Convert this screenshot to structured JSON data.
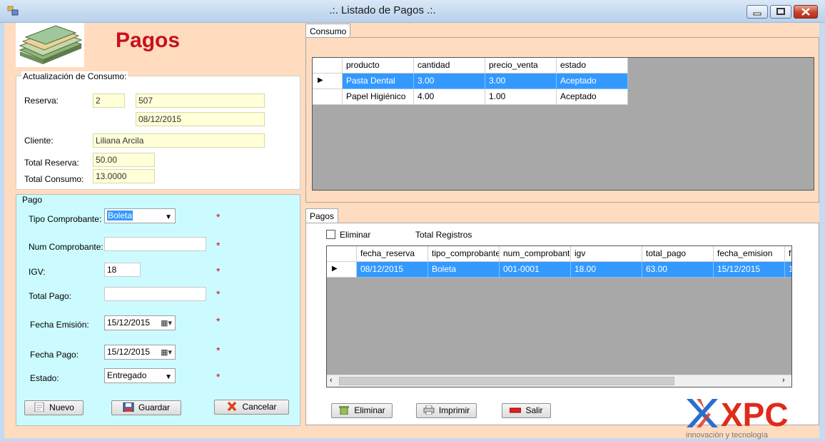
{
  "window": {
    "title": ".:. Listado de Pagos .:."
  },
  "header": {
    "title": "Pagos"
  },
  "actualizacion": {
    "legend": "Actualización de Consumo:",
    "reserva_label": "Reserva:",
    "reserva_id": "2",
    "habitacion": "507",
    "fecha": "08/12/2015",
    "cliente_label": "Cliente:",
    "cliente": "Liliana Arcila",
    "total_reserva_label": "Total Reserva:",
    "total_reserva": "50.00",
    "total_consumo_label": "Total Consumo:",
    "total_consumo": "13.0000"
  },
  "pago": {
    "legend": "Pago",
    "tipo_label": "Tipo Comprobante:",
    "tipo_value": "Boleta",
    "num_label": "Num Comprobante:",
    "num_value": "",
    "igv_label": "IGV:",
    "igv_value": "18",
    "total_label": "Total Pago:",
    "total_value": "",
    "fecha_emision_label": "Fecha Emisión:",
    "fecha_emision": "15/12/2015",
    "fecha_pago_label": "Fecha Pago:",
    "fecha_pago": "15/12/2015",
    "estado_label": "Estado:",
    "estado_value": "Entregado",
    "required": "*"
  },
  "buttons": {
    "nuevo": "Nuevo",
    "guardar": "Guardar",
    "cancelar": "Cancelar",
    "eliminar": "Eliminar",
    "imprimir": "Imprimir",
    "salir": "Salir"
  },
  "consumo_tab": {
    "label": "Consumo",
    "columns": [
      "producto",
      "cantidad",
      "precio_venta",
      "estado"
    ],
    "rows": [
      [
        "Pasta Dental",
        "3.00",
        "3.00",
        "Aceptado"
      ],
      [
        "Papel Higiénico",
        "4.00",
        "1.00",
        "Aceptado"
      ]
    ]
  },
  "pagos_tab": {
    "label": "Pagos",
    "eliminar_check": "Eliminar",
    "total_registros": "Total Registros",
    "columns": [
      "fecha_reserva",
      "tipo_comprobante",
      "num_comprobante",
      "igv",
      "total_pago",
      "fecha_emision",
      "f"
    ],
    "rows": [
      [
        "08/12/2015",
        "Boleta",
        "001-0001",
        "18.00",
        "63.00",
        "15/12/2015",
        "1"
      ]
    ]
  },
  "logo": {
    "text": "XPC",
    "tagline": "innovación y tecnología"
  },
  "colors": {
    "title_red": "#c8101b",
    "selection": "#3399ff",
    "pago_bg": "#ccfbff",
    "form_bg": "#ffdcc0",
    "readonly_bg": "#ffffd8"
  }
}
